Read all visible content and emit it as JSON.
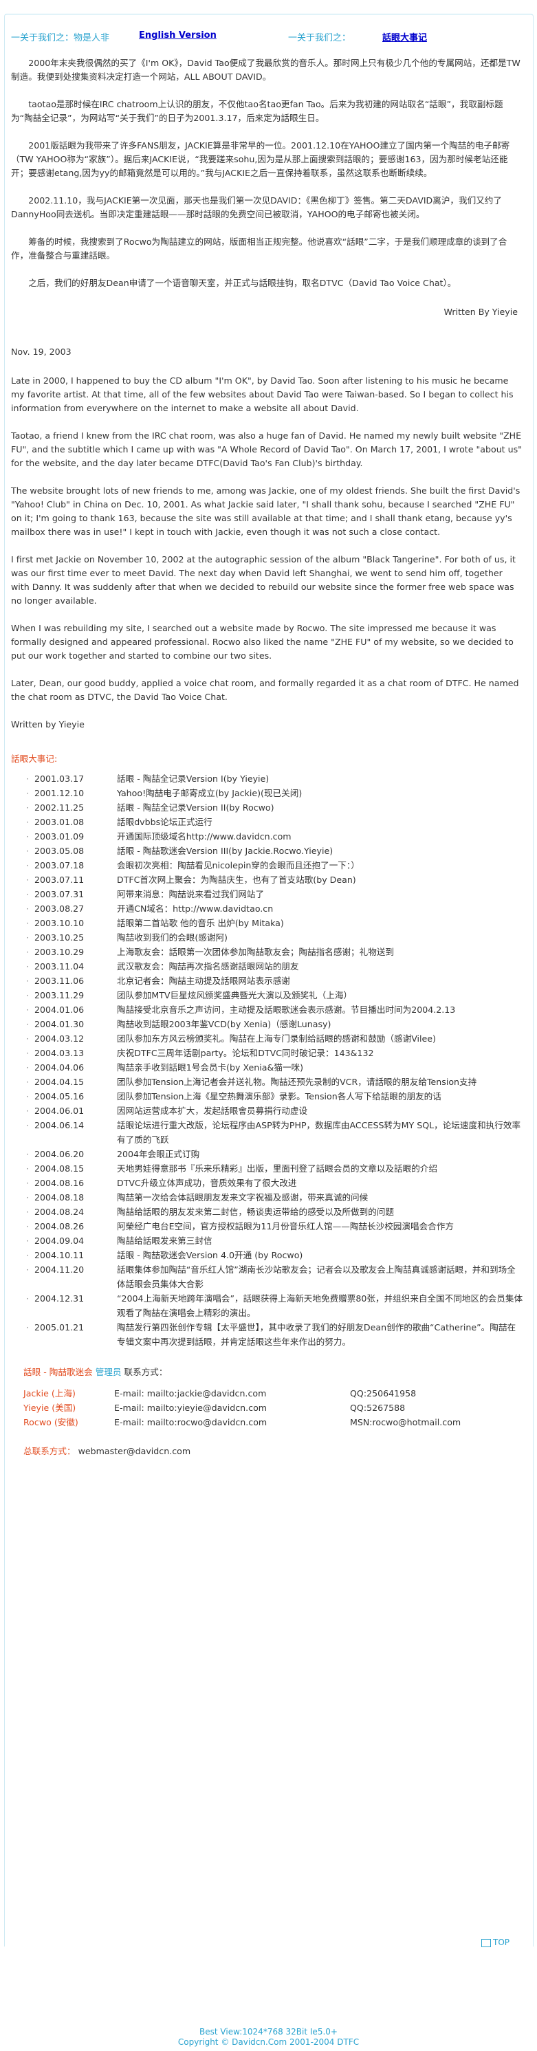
{
  "topbar": {
    "label_left": "一关于我们之：物是人非",
    "link_left": "English Version",
    "label_right": "一关于我们之：",
    "link_right": "話眼大事记"
  },
  "chinese_paragraphs": [
    "2000年末夹我很偶然的买了《I'm OK》，David Tao便成了我最欣赏的音乐人。那时网上只有极少几个他的专属网站，还都是TW制造。我便到处搜集资料决定打造一个网站，ALL ABOUT DAVID。",
    "taotao是那时候在IRC chatroom上认识的朋友，不仅他tao名tao更fan Tao。后来为我初建的网站取名“話眼”，我取副标题为“陶喆全记录”，为网站写“关于我们”的日子为2001.3.17，后来定为話眼生日。",
    "2001版話眼为我带来了许多FANS朋友，JACKIE算是非常早的一位。2001.12.10在YAHOO建立了国内第一个陶喆的电子邮寄（TW YAHOO称为“家族”）。据后来JACKIE说，“我要蹉来sohu,因为是从那上面搜索到話眼的；要感谢163，因为那时候老站还能开；要感谢etang,因为yy的邮箱竟然是可以用的。”我与JACKIE之后一直保持着联系，虽然这联系也断断续续。",
    "2002.11.10，我与JACKIE第一次见面，那天也是我们第一次见DAVID：《黑色柳丁》签售。第二天DAVID离沪，我们又约了DannyHoo同去送机。当即决定重建話眼——那时話眼的免费空间已被取消，YAHOO的电子邮寄也被关闭。",
    "筹备的时候，我搜索到了Rocwo为陶喆建立的网站，版面相当正规完整。他说喜欢“話眼”二字，于是我们顺理成章的谈到了合作，准备整合与重建話眼。",
    "之后，我们的好朋友Dean申请了一个语音聊天室，并正式与話眼挂钩，取名DTVC（David Tao Voice Chat）。"
  ],
  "signature_cn": "Written By Yieyie",
  "date": "Nov. 19, 2003",
  "english_paragraphs": [
    "Late in 2000, I happened to buy the CD album \"I'm OK\", by David Tao. Soon after listening to his music he became my favorite artist. At that time, all of the few websites about David Tao were Taiwan-based. So I began to collect his information from everywhere on the internet to make a website all about David.",
    "Taotao, a friend I knew from the IRC chat room, was also a huge fan of David. He named my newly built website \"ZHE FU\", and the subtitle which I came up with was \"A Whole Record of David Tao\". On March 17, 2001, I wrote \"about us\" for the website, and the day later became DTFC(David Tao's Fan Club)'s birthday.",
    "The website brought lots of new friends to me, among was Jackie, one of my oldest friends. She built the first David's \"Yahoo! Club\" in China on Dec. 10, 2001. As what Jackie said later, \"I shall thank sohu, because I searched \"ZHE FU\" on it; I'm going to thank 163, because the site was still available at that time; and I shall thank etang, because yy's mailbox there was in use!\" I kept in touch with Jackie, even though it was not such a close contact.",
    "I first met Jackie on November 10, 2002 at the autographic session of the album \"Black Tangerine\". For both of us, it was our first time ever to meet David. The next day when David left Shanghai, we went to send him off, together with Danny. It was suddenly after that when we decided to rebuild our website since the former free web space was no longer available.",
    "When I was rebuilding my site, I searched out a website made by Rocwo. The site impressed me because it was formally designed and appeared professional. Rocwo also liked the name \"ZHE FU\" of my website, so we decided to put our work together and started to combine our two sites.",
    "Later, Dean, our good buddy, applied a voice chat room, and formally regarded it as a chat room of DTFC. He named the chat room as DTVC, the David Tao Voice Chat."
  ],
  "written_by_en": "Written by Yieyie",
  "events_title": "話眼大事记:",
  "bullet": "·",
  "events": [
    {
      "date": "2001.03.17",
      "text": "話眼 - 陶喆全记录Version I(by Yieyie)"
    },
    {
      "date": "2001.12.10",
      "text": "Yahoo!陶喆电子邮寄成立(by Jackie)(现已关闭)"
    },
    {
      "date": "2002.11.25",
      "text": "話眼 - 陶喆全记录Version II(by Rocwo)"
    },
    {
      "date": "2003.01.08",
      "text": "話眼dvbbs论坛正式运行"
    },
    {
      "date": "2003.01.09",
      "text": "开通国际顶级域名http://www.davidcn.com"
    },
    {
      "date": "2003.05.08",
      "text": "話眼 - 陶喆歌迷会Version III(by Jackie.Rocwo.Yieyie)"
    },
    {
      "date": "2003.07.18",
      "text": "会眼初次亮相：陶喆看见nicolepin穿的会眼而且还抱了一下：）"
    },
    {
      "date": "2003.07.11",
      "text": "DTFC首次网上聚会：为陶喆庆生，也有了首支站歌(by Dean)"
    },
    {
      "date": "2003.07.31",
      "text": "阿带来消息：陶喆说来看过我们网站了"
    },
    {
      "date": "2003.08.27",
      "text": "开通CN域名：http://www.davidtao.cn"
    },
    {
      "date": "2003.10.10",
      "text": "話眼第二首站歌 他的音乐 出炉(by Mitaka)"
    },
    {
      "date": "2003.10.25",
      "text": "陶喆收到我们的会眼(感谢阿)"
    },
    {
      "date": "2003.10.29",
      "text": "上海歌友会：話眼第一次团体参加陶喆歌友会；陶喆指名感谢；礼物送到"
    },
    {
      "date": "2003.11.04",
      "text": "武汉歌友会：陶喆再次指名感谢話眼网站的朋友"
    },
    {
      "date": "2003.11.06",
      "text": "北京记者会：陶喆主动提及話眼网站表示感谢"
    },
    {
      "date": "2003.11.29",
      "text": "团队参加MTV巨星炫风颁奖盛典暨光大演以及颁奖礼（上海）"
    },
    {
      "date": "2004.01.06",
      "text": "陶喆接受北京音乐之声访问，主动提及話眼歌迷会表示感谢。节目播出时间为2004.2.13"
    },
    {
      "date": "2004.01.30",
      "text": "陶喆收到話眼2003年鉴VCD(by Xenia)（感谢Lunasy)"
    },
    {
      "date": "2004.03.12",
      "text": "团队参加东方风云榜颁奖礼。陶喆在上海专门录制给話眼的感谢和鼓励（感谢Vilee)"
    },
    {
      "date": "2004.03.13",
      "text": "庆祝DTFC三周年话剧party。论坛和DTVC同时破记录：143&132"
    },
    {
      "date": "2004.04.06",
      "text": "陶喆亲手收到話眼1号会员卡(by Xenia&猫一咪)"
    },
    {
      "date": "2004.04.15",
      "text": "团队参加Tension上海记者会并送礼物。陶喆还预先录制的VCR，请話眼的朋友给Tension支持"
    },
    {
      "date": "2004.05.16",
      "text": "团队参加Tension上海《星空热舞演乐部》录影。Tension各人写下给話眼的朋友的话"
    },
    {
      "date": "2004.06.01",
      "text": "因网站运营成本扩大，发起話眼會员募捐行动虚设"
    },
    {
      "date": "2004.06.14",
      "text": "話眼论坛进行重大改版，论坛程序由ASP转为PHP，数据库由ACCESS转为MY SQL，论坛速度和执行效率有了质的飞跃"
    },
    {
      "date": "2004.06.20",
      "text": "2004年会眼正式订购"
    },
    {
      "date": "2004.08.15",
      "text": "天地男娃得意那书『乐来乐精彩』出版，里面刊登了話眼会员的文章以及話眼的介绍"
    },
    {
      "date": "2004.08.16",
      "text": "DTVC升级立体声成功，音质效果有了很大改进"
    },
    {
      "date": "2004.08.18",
      "text": "陶喆第一次给会体話眼朋友发来文字祝福及感谢，带来真诚的问候"
    },
    {
      "date": "2004.08.24",
      "text": "陶喆给話眼的朋友发来第二封信，畅谈奥运带给的感受以及所做到的问题"
    },
    {
      "date": "2004.08.26",
      "text": "阿榮经广电台E空间，官方授权話眼为11月份音乐红人馆——陶喆长沙校园演唱会合作方"
    },
    {
      "date": "2004.09.04",
      "text": "陶喆给話眼发来第三封信"
    },
    {
      "date": "2004.10.11",
      "text": "話眼 - 陶喆歌迷会Version 4.0开通 (by Rocwo)"
    },
    {
      "date": "2004.11.20",
      "text": "話眼集体参加陶喆“音乐红人馆”湖南长沙站歌友会；记者会以及歌友会上陶喆真诚感谢話眼，并和到场全体話眼会员集体大合影"
    },
    {
      "date": "2004.12.31",
      "text": "“2004上海新天地跨年演唱会”，話眼获得上海新天地免费赠票80张，并组织来自全国不同地区的会员集体观看了陶喆在演唱会上精彩的演出。"
    },
    {
      "date": "2005.01.21",
      "text": "陶喆发行第四张创作专辑【太平盛世】，其中收录了我们的好朋友Dean创作的歌曲“Catherine”。陶喆在专辑文案中再次提到話眼，并肯定話眼这些年来作出的努力。"
    }
  ],
  "contact": {
    "title_a": "話眼 - 陶喆歌迷会",
    "title_b": " 管理员",
    "title_c": " 联系方式：",
    "rows": [
      {
        "name": "Jackie (上海)",
        "mail": "E-mail: mailto:jackie@davidcn.com",
        "im": "QQ:250641958"
      },
      {
        "name": "Yieyie (美国)",
        "mail": "E-mail: mailto:yieyie@davidcn.com",
        "im": "QQ:5267588"
      },
      {
        "name": "Rocwo (安徽)",
        "mail": "E-mail: mailto:rocwo@davidcn.com",
        "im": "MSN:rocwo@hotmail.com"
      }
    ],
    "general_label": "总联系方式：",
    "general_value": "webmaster@davidcn.com"
  },
  "top_link": "TOP",
  "footer": {
    "line1": "Best View:1024*768 32Bit Ie5.0+",
    "line2": "Copyright © Davidcn.Com 2001-2004 DTFC"
  },
  "colors": {
    "accent_blue": "#2aa3cf",
    "link_blue": "#0000cc",
    "accent_red": "#e24c20",
    "text": "#333333"
  }
}
